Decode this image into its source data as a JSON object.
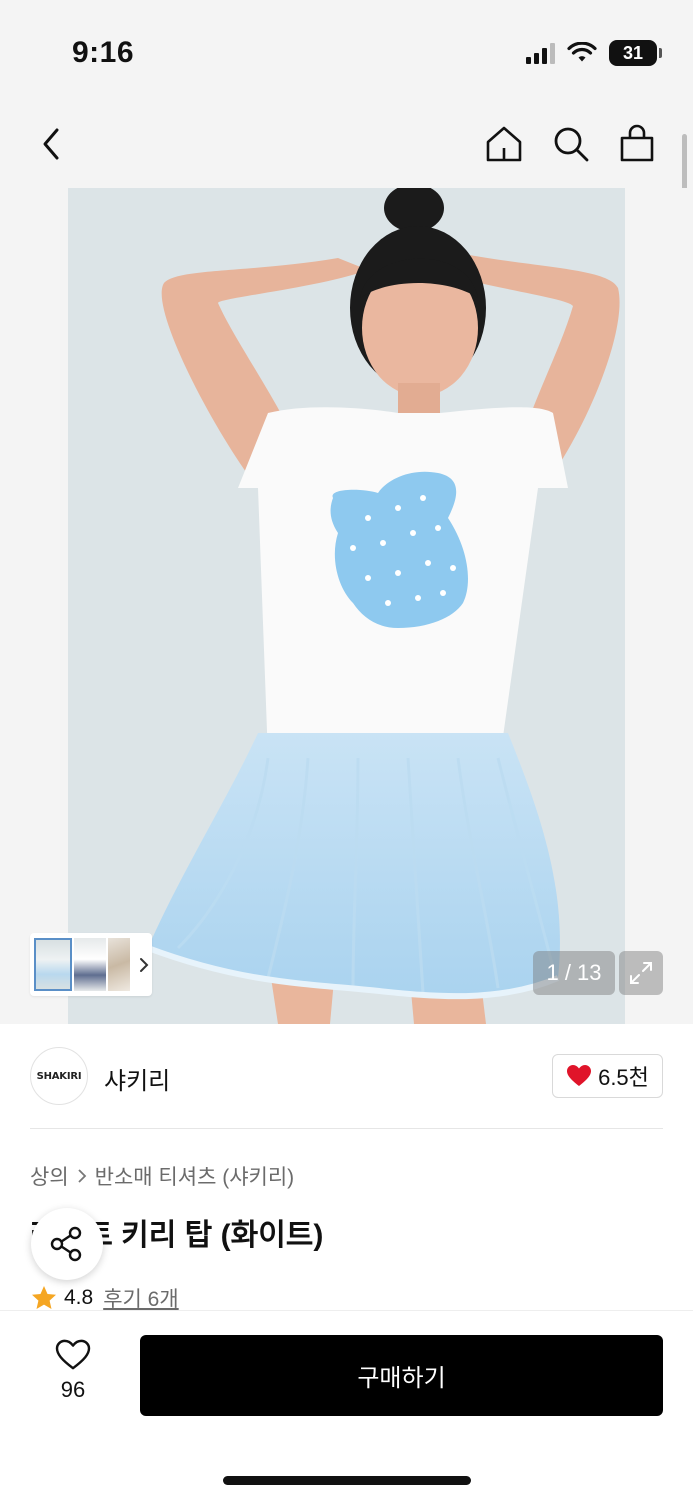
{
  "status_bar": {
    "time": "9:16",
    "battery": "31"
  },
  "nav": {
    "back_icon": "chevron-left-icon",
    "home_icon": "home-icon",
    "search_icon": "search-icon",
    "bag_icon": "shopping-bag-icon"
  },
  "gallery": {
    "page_counter": "1 / 13",
    "expand_icon": "expand-icon",
    "thumbnail_count": 3
  },
  "brand": {
    "logo_text": "SHAKIRI",
    "name": "샤키리",
    "like_count": "6.5천",
    "like_color": "#e0142a"
  },
  "product": {
    "breadcrumb": [
      "상의",
      "반소매 티셔츠 (샤키리)"
    ],
    "title": "라이트 키리 탑 (화이트)",
    "rating": "4.8",
    "review_label": "후기 6개",
    "star_color": "#f5a623"
  },
  "bottom_bar": {
    "wish_count": "96",
    "buy_label": "구매하기"
  }
}
